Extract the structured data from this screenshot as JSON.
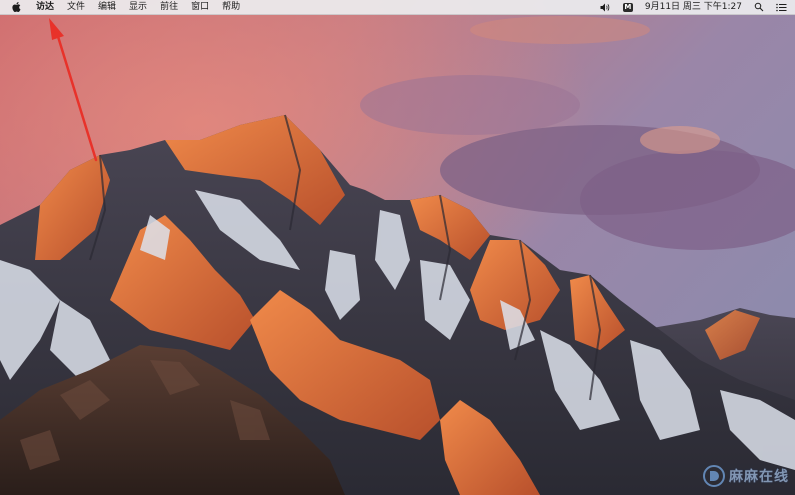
{
  "menubar": {
    "apple_icon": "apple-logo-icon",
    "items": [
      "访达",
      "文件",
      "编辑",
      "显示",
      "前往",
      "窗口",
      "帮助"
    ],
    "status": {
      "volume_icon": "volume-icon",
      "input_method_icon": "input-method-icon",
      "input_method_label": "M",
      "datetime": "9月11日 周三 下午1:27",
      "search_icon": "search-icon",
      "notification_icon": "notification-center-icon"
    }
  },
  "desktop": {
    "wallpaper": "macOS Sierra mountains at sunset",
    "annotation": "red-arrow-pointing-to-finder-menu"
  },
  "watermark": {
    "text": "麻麻在线"
  },
  "colors": {
    "menubar_bg": "#ececee",
    "arrow": "#e8322a",
    "sky_top": "#c46a6e",
    "sky_right": "#8d7fa6",
    "mountain_lit": "#d9693a",
    "mountain_shadow": "#3c3d4a",
    "snow": "#dfe3ec"
  }
}
